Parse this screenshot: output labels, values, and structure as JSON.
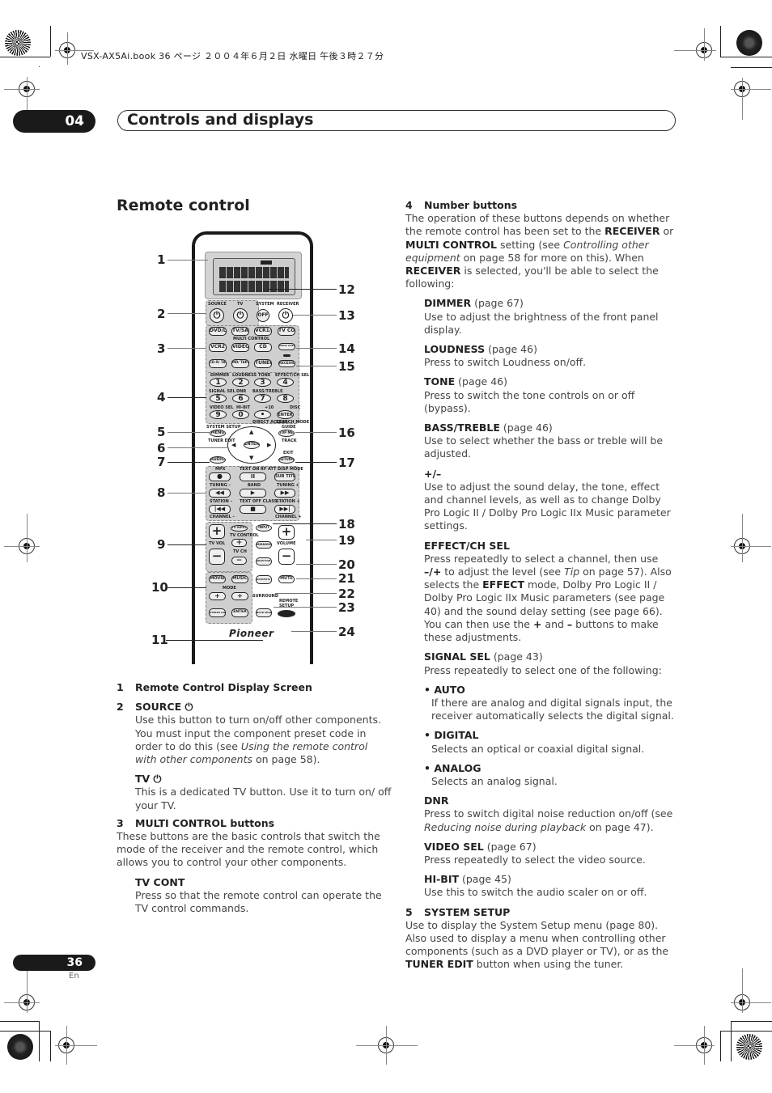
{
  "print_header": "VSX-AX5Ai.book  36 ページ  ２００４年６月２日  水曜日  午後３時２７分",
  "chapter": {
    "number": "04",
    "title": "Controls and displays"
  },
  "section_title": "Remote control",
  "footer": {
    "page_number": "36",
    "language": "En"
  },
  "remote_diagram": {
    "callouts_left": [
      "1",
      "2",
      "3",
      "4",
      "5",
      "6",
      "7",
      "8",
      "9",
      "10",
      "11"
    ],
    "callouts_right": [
      "12",
      "13",
      "14",
      "15",
      "16",
      "17",
      "18",
      "19",
      "20",
      "21",
      "22",
      "23",
      "24"
    ],
    "labels": {
      "source": "SOURCE",
      "tv": "TV",
      "system": "SYSTEM",
      "receiver": "RECEIVER",
      "off": "OFF",
      "multi_control": "MULTI CONTROL",
      "dvd_ld": "DVD/LD",
      "tv_sat": "TV/SAT",
      "vcr1_dvr": "VCR1/ DVR",
      "tv_cont": "TV CONT",
      "vcr2": "VCR2",
      "video": "VIDEO",
      "cd": "CD",
      "cd_r_tape1": "CD-R/ TAPE1",
      "md_tape2": "MD/ TAPE2",
      "tuner": "TUNER",
      "multi_operation": "MULTI OPERATION",
      "receiver_btn": "RECEIVER",
      "dimmer": "DIMMER",
      "loudness": "LOUDNESS",
      "tone": "TONE",
      "effect_ch_sel": "EFFECT/CH SEL",
      "signal_sel": "SIGNAL SEL",
      "dnr": "DNR",
      "bass_treble": "BASS/TREBLE",
      "video_sel": "VIDEO SEL",
      "hi_bit": "HI-BIT",
      "plus10": "+10",
      "disc": "DISC",
      "direct_access": "DIRECT ACCESS",
      "search_mode": "SEARCH MODE",
      "digits": [
        "1",
        "2",
        "3",
        "4",
        "5",
        "6",
        "7",
        "8",
        "9",
        "0",
        "•",
        "ENTER"
      ],
      "system_setup": "SYSTEM SETUP",
      "menu": "MENU",
      "tuner_edit": "TUNER EDIT",
      "guide": "GUIDE",
      "top_menu": "TOP MENU",
      "track": "TRACK",
      "enter": "ENTER",
      "audio": "AUDIO",
      "exit": "EXIT",
      "return": "RETURN",
      "mpx": "MPX",
      "text_on_rf_att": "TEXT ON  RF ATT",
      "disp_mode": "DISP MODE",
      "subtitle": "SUB TITLE",
      "tuning_minus": "TUNING –",
      "band": "BAND",
      "tuning_plus": "TUNING +",
      "station_minus": "STATION –",
      "text_off_class": "TEXT OFF  CLASS",
      "station_plus": "STATION +",
      "channel_minus": "CHANNEL –",
      "channel_plus": "CHANNEL +",
      "tv_input": "TV INPUT",
      "tv_control": "TV CONTROL",
      "tv_vol": "TV VOL",
      "tv_ch": "TV CH",
      "input": "INPUT",
      "midnight": "MIDNIGHT",
      "volume": "VOLUME",
      "rec_input": "SELECTOR INPUT",
      "movie": "MOVIE",
      "music": "MUSIC",
      "mode": "MODE",
      "surround": "SURROUND",
      "stereo_direct": "STEREO DIRECT",
      "mode_enter": "ENTER",
      "acoustic_eq": "ACOUSTIC EQ",
      "mute": "MUTE",
      "remote_setup": "REMOTE SETUP",
      "dsp_mode": "BACK MODE",
      "brand": "Pioneer"
    }
  },
  "left_column": [
    {
      "num": "1",
      "heading": "Remote Control Display Screen"
    },
    {
      "num": "2",
      "heading": "SOURCE ⏻",
      "body": [
        "Use this button to turn on/off other components. You must input the component preset code in order to do this (see ",
        {
          "i": "Using the remote control with other components"
        },
        " on page 58)."
      ],
      "subs": [
        {
          "heading": "TV ⏻",
          "body": "This is a dedicated TV button. Use it to turn on/ off your TV."
        }
      ]
    },
    {
      "num": "3",
      "heading": "MULTI CONTROL buttons",
      "body": "These buttons are the basic controls that switch the mode of the receiver and the remote control, which allows you to control your other components.",
      "subs": [
        {
          "heading": "TV CONT",
          "body": "Press so that the remote control can operate the TV control commands."
        }
      ]
    }
  ],
  "right_column": {
    "item4": {
      "num": "4",
      "heading": "Number buttons",
      "intro_parts": [
        "The operation of these buttons depends on whether the remote control has been set to the ",
        {
          "b": "RECEIVER"
        },
        " or ",
        {
          "b": "MULTI CONTROL"
        },
        " setting (see ",
        {
          "i": "Controlling other equipment"
        },
        " on page 58 for more on this). When ",
        {
          "b": "RECEIVER"
        },
        " is selected, you'll be able to select the following:"
      ],
      "subs": [
        {
          "heading": "DIMMER",
          "page": "(page 67)",
          "body": "Use to adjust the brightness of the front panel display."
        },
        {
          "heading": "LOUDNESS",
          "page": "(page 46)",
          "body": "Press to switch Loudness on/off."
        },
        {
          "heading": "TONE",
          "page": "(page 46)",
          "body": "Press to switch the tone controls on or off (bypass)."
        },
        {
          "heading": "BASS/TREBLE",
          "page": "(page 46)",
          "body": "Use to select whether the bass or treble will be adjusted."
        },
        {
          "heading": "+/–",
          "page": "",
          "body": "Use to adjust the sound delay, the tone, effect and channel levels, as well as to change Dolby Pro Logic II / Dolby Pro Logic IIx Music parameter settings."
        },
        {
          "heading": "EFFECT/CH SEL",
          "page": "",
          "body_parts": [
            "Press repeatedly to select a channel, then use ",
            {
              "b": "–/+"
            },
            " to adjust the level (see ",
            {
              "i": "Tip"
            },
            " on page 57). Also selects the ",
            {
              "b": "EFFECT"
            },
            " mode, Dolby Pro Logic II / Dolby Pro Logic IIx Music parameters (see page 40) and the sound delay setting (see page 66). You can then use the ",
            {
              "b": "+"
            },
            " and ",
            {
              "b": "–"
            },
            " buttons to make these adjustments."
          ]
        },
        {
          "heading": "SIGNAL SEL",
          "page": "(page 43)",
          "body": "Press repeatedly to select one of the following:"
        }
      ],
      "signal_options": [
        {
          "heading": "• AUTO",
          "body": "If there are analog and digital signals input, the receiver automatically selects the digital signal."
        },
        {
          "heading": "• DIGITAL",
          "body": "Selects an optical or coaxial digital signal."
        },
        {
          "heading": "• ANALOG",
          "body": "Selects an analog signal."
        }
      ],
      "subs2": [
        {
          "heading": "DNR",
          "page": "",
          "body_parts": [
            "Press to switch digital noise reduction on/off (see ",
            {
              "i": "Reducing noise during playback"
            },
            " on page 47)."
          ]
        },
        {
          "heading": "VIDEO SEL",
          "page": "(page 67)",
          "body": "Press repeatedly to select the video source."
        },
        {
          "heading": "HI-BIT",
          "page": "(page 45)",
          "body": "Use this to switch the audio scaler on or off."
        }
      ]
    },
    "item5": {
      "num": "5",
      "heading": "SYSTEM SETUP",
      "body_parts": [
        "Use to display the System Setup menu (page 80). Also used to display a menu when controlling other components (such as a DVD player or TV), or as the ",
        {
          "b": "TUNER EDIT"
        },
        " button when using the tuner."
      ]
    }
  }
}
